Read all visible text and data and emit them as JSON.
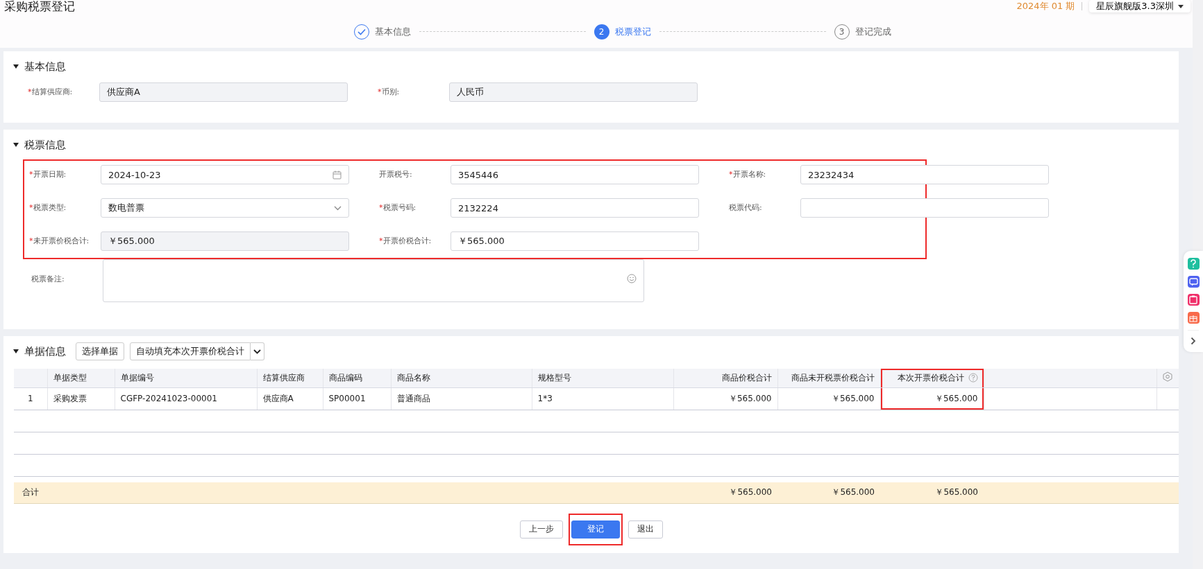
{
  "page_title": "采购税票登记",
  "period": "2024年 01 期",
  "account": "星辰旗舰版3.3深圳",
  "steps": [
    {
      "label": "基本信息",
      "completed": true,
      "current": false
    },
    {
      "number": "2",
      "label": "税票登记",
      "completed": false,
      "current": true
    },
    {
      "number": "3",
      "label": "登记完成",
      "completed": false,
      "current": false
    }
  ],
  "basic_section": {
    "title": "基本信息",
    "expanded": true,
    "fields": [
      {
        "mark": "*",
        "label": "结算供应商:",
        "kind": "readonly",
        "value": "供应商A"
      },
      {
        "mark": "*",
        "label": "币别:",
        "kind": "readonly",
        "value": "人民币"
      }
    ]
  },
  "invoice_section": {
    "title": "税票信息",
    "expanded": true,
    "highlighted": true,
    "fields": [
      {
        "mark": "*",
        "label": "开票日期:",
        "kind": "date",
        "value": "2024-10-23"
      },
      {
        "label": "开票税号:",
        "kind": "text",
        "value": "3545446"
      },
      {
        "mark": "*",
        "label": "开票名称:",
        "kind": "text",
        "value": "23232434"
      },
      {
        "mark": "*",
        "label": "税票类型:",
        "kind": "select",
        "value": "数电普票"
      },
      {
        "mark": "*",
        "label": "税票号码:",
        "kind": "text",
        "value": "2132224"
      },
      {
        "label": "税票代码:",
        "kind": "text"
      },
      {
        "mark": "*",
        "label": "未开票价税合计:",
        "kind": "readonly",
        "value": "￥565.000"
      },
      {
        "mark": "*",
        "label": "开票价税合计:",
        "kind": "text",
        "value": "￥565.000"
      }
    ],
    "remark": {
      "label": "税票备注:",
      "kind": "textarea"
    }
  },
  "document_section": {
    "title": "单据信息",
    "expanded": true,
    "select_button": "选择单据",
    "autofill_button": "自动填充本次开票价税合计",
    "table": {
      "columns": [
        {
          "label": "单据类型",
          "highlighted": false,
          "help": false
        },
        {
          "label": "单据编号",
          "highlighted": false,
          "help": false
        },
        {
          "label": "结算供应商",
          "highlighted": false,
          "help": false
        },
        {
          "label": "商品编码",
          "highlighted": false,
          "help": false
        },
        {
          "label": "商品名称",
          "highlighted": false,
          "help": false
        },
        {
          "label": "规格型号",
          "highlighted": false,
          "help": false
        },
        {
          "label": "商品价税合计",
          "highlighted": false,
          "help": false
        },
        {
          "label": "商品未开税票价税合计",
          "highlighted": false,
          "help": false
        },
        {
          "label": "本次开票价税合计",
          "highlighted": true,
          "help": true
        }
      ],
      "rows": [
        {
          "index": "1",
          "cells": [
            "采购发票",
            "CGFP-20241023-00001",
            "供应商A",
            "SP00001",
            "普通商品",
            "1*3",
            "￥565.000",
            "￥565.000",
            "￥565.000"
          ]
        }
      ],
      "total": {
        "label": "合计",
        "cells": [
          "",
          "",
          "",
          "",
          "",
          "",
          "￥565.000",
          "￥565.000",
          "￥565.000"
        ]
      }
    }
  },
  "buttons": [
    {
      "label": "上一步",
      "kind": "default",
      "highlighted": false
    },
    {
      "label": "登记",
      "kind": "primary",
      "highlighted": true
    },
    {
      "label": "退出",
      "kind": "default",
      "highlighted": false
    }
  ]
}
